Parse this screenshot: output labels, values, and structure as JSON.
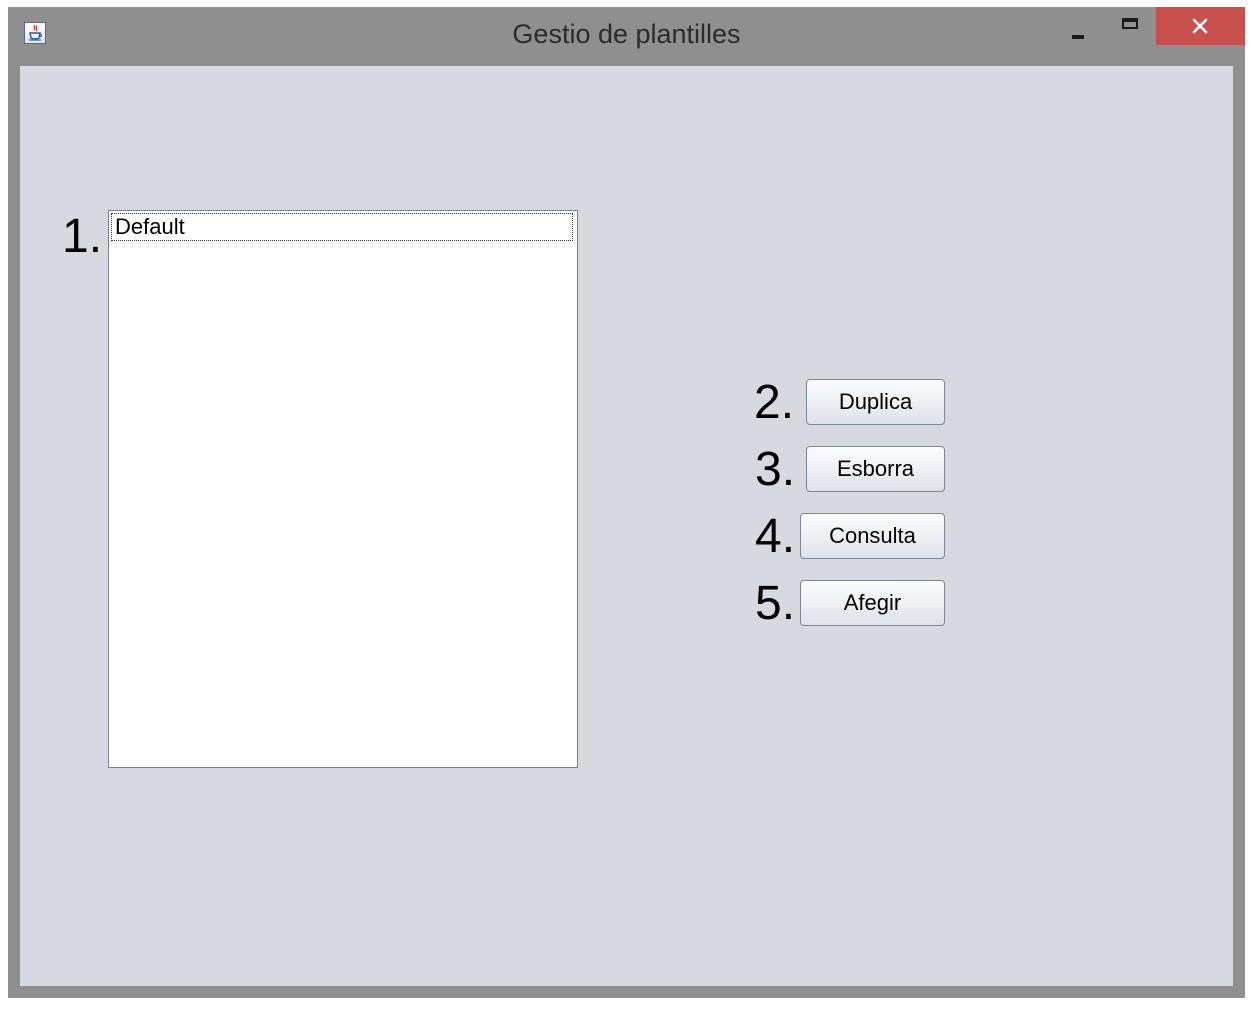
{
  "window": {
    "title": "Gestio de plantilles",
    "icon": "java-cup-icon"
  },
  "list": {
    "number": "1.",
    "items": [
      "Default"
    ]
  },
  "buttons": [
    {
      "number": "2.",
      "label": "Duplica"
    },
    {
      "number": "3.",
      "label": "Esborra"
    },
    {
      "number": "4.",
      "label": "Consulta"
    },
    {
      "number": "5.",
      "label": "Afegir"
    }
  ],
  "colors": {
    "titlebar": "#8f8f8f",
    "client_background": "#d6d9e0",
    "close_button": "#c7504c"
  }
}
